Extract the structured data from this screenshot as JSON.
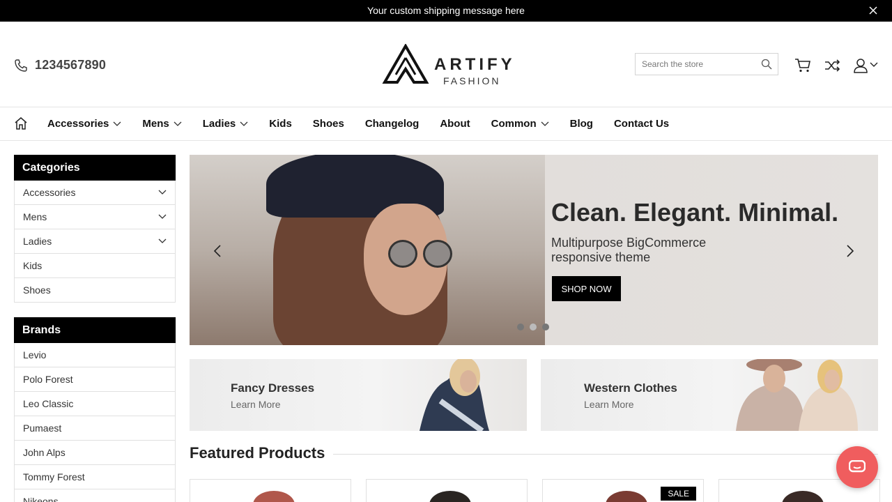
{
  "announcement": {
    "message": "Your custom shipping message here"
  },
  "header": {
    "phone": "1234567890",
    "logo_word": "ARTIFY",
    "logo_sub": "FASHION",
    "search_placeholder": "Search the store"
  },
  "nav": {
    "items": [
      {
        "label": "Accessories",
        "dropdown": true
      },
      {
        "label": "Mens",
        "dropdown": true
      },
      {
        "label": "Ladies",
        "dropdown": true
      },
      {
        "label": "Kids",
        "dropdown": false
      },
      {
        "label": "Shoes",
        "dropdown": false
      },
      {
        "label": "Changelog",
        "dropdown": false
      },
      {
        "label": "About",
        "dropdown": false
      },
      {
        "label": "Common",
        "dropdown": true
      },
      {
        "label": "Blog",
        "dropdown": false
      },
      {
        "label": "Contact Us",
        "dropdown": false
      }
    ]
  },
  "sidebar": {
    "categories_title": "Categories",
    "categories": [
      {
        "label": "Accessories",
        "expandable": true
      },
      {
        "label": "Mens",
        "expandable": true
      },
      {
        "label": "Ladies",
        "expandable": true
      },
      {
        "label": "Kids",
        "expandable": false
      },
      {
        "label": "Shoes",
        "expandable": false
      }
    ],
    "brands_title": "Brands",
    "brands": [
      "Levio",
      "Polo Forest",
      "Leo Classic",
      "Pumaest",
      "John Alps",
      "Tommy Forest",
      "Nikeons"
    ]
  },
  "hero": {
    "headline": "Clean. Elegant. Minimal.",
    "subline": "Multipurpose BigCommerce responsive theme",
    "cta": "SHOP NOW"
  },
  "banners": [
    {
      "title": "Fancy Dresses",
      "link": "Learn More"
    },
    {
      "title": "Western Clothes",
      "link": "Learn More"
    }
  ],
  "featured": {
    "title": "Featured Products",
    "sale_badge": "SALE"
  },
  "colors": {
    "topbar": "#000000",
    "chat": "#f05d5e"
  }
}
